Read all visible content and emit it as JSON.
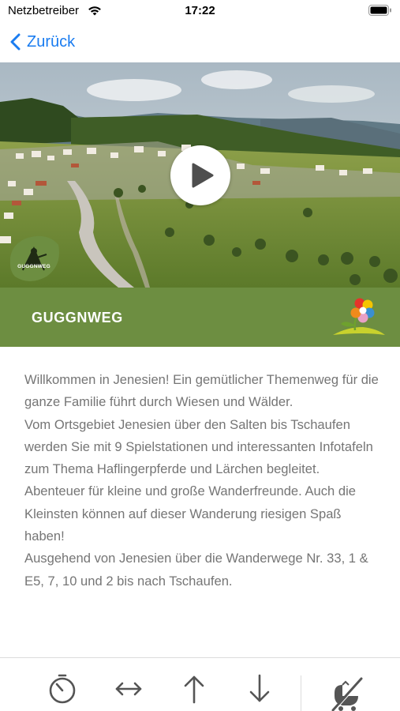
{
  "status_bar": {
    "carrier": "Netzbetreiber",
    "time": "17:22",
    "icons": [
      "wifi-icon",
      "battery-icon"
    ]
  },
  "nav": {
    "back_label": "Zurück",
    "icon": "chevron-left-icon"
  },
  "hero": {
    "logo_text": "GUGGNWEG",
    "play_icon": "play-icon"
  },
  "title_bar": {
    "title": "GUGGNWEG",
    "icon": "flower-icon"
  },
  "description": [
    "Willkommen in Jenesien! Ein gemütlicher Themenweg für die ganze Familie führt durch Wiesen und Wälder.",
    "Vom Ortsgebiet Jenesien über den Salten bis Tschaufen werden Sie mit 9 Spielstationen und interessanten Infotafeln zum Thema Haflingerpferde und Lärchen begleitet. Abenteuer für kleine und große Wanderfreunde. Auch die Kleinsten können auf dieser Wanderung riesigen Spaß haben!",
    "Ausgehend von Jenesien über die Wanderwege Nr. 33, 1 & E5, 7, 10 und 2 bis nach Tschaufen."
  ],
  "toolbar": {
    "items": [
      {
        "icon": "duration-icon"
      },
      {
        "icon": "distance-icon"
      },
      {
        "icon": "ascent-icon"
      },
      {
        "icon": "descent-icon"
      },
      {
        "icon": "no-stroller-icon"
      }
    ]
  },
  "colors": {
    "accent_blue": "#1a7cf0",
    "title_bar_green": "#6d8e41",
    "text_gray": "#757575",
    "icon_gray": "#555555"
  }
}
